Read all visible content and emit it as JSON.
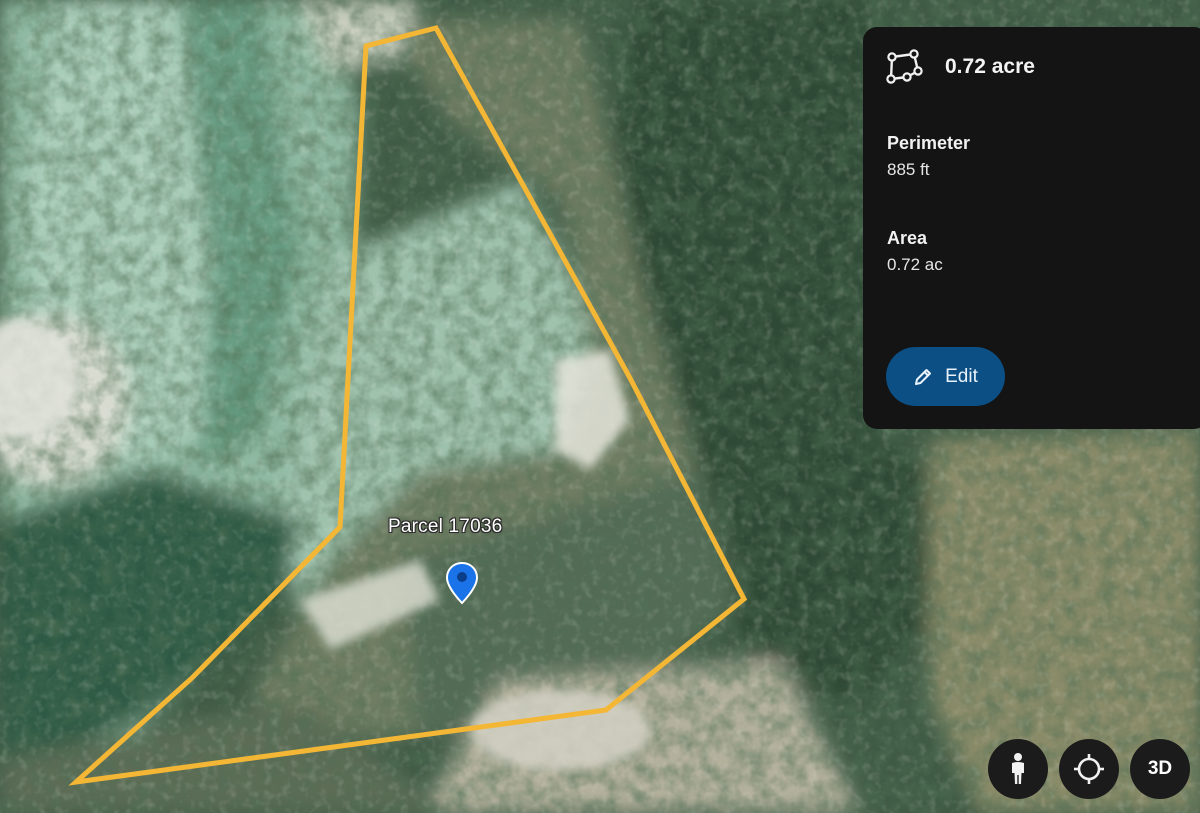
{
  "map": {
    "view": "satellite",
    "parcel": {
      "label": "Parcel 17036",
      "outline_color": "#f4b635"
    },
    "pin": {
      "icon": "location-pin-icon",
      "color": "#1a73e8"
    }
  },
  "panel": {
    "icon": "polygon-measure-icon",
    "title": "0.72 acre",
    "perimeter": {
      "label": "Perimeter",
      "value": "885 ft"
    },
    "area": {
      "label": "Area",
      "value": "0.72 ac"
    },
    "edit": {
      "icon": "pencil-icon",
      "label": "Edit",
      "color": "#0b4f85"
    }
  },
  "controls": {
    "street_view": {
      "icon": "pegman-icon"
    },
    "my_location": {
      "icon": "crosshair-icon"
    },
    "three_d": {
      "label": "3D"
    }
  }
}
